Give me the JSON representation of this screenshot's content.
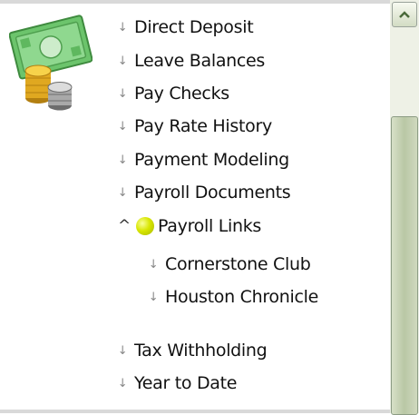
{
  "menu": {
    "items": [
      {
        "label": "Direct Deposit",
        "bullet": "↓"
      },
      {
        "label": "Leave Balances",
        "bullet": "↓"
      },
      {
        "label": "Pay Checks",
        "bullet": "↓"
      },
      {
        "label": "Pay Rate History",
        "bullet": "↓"
      },
      {
        "label": "Payment Modeling",
        "bullet": "↓"
      },
      {
        "label": "Payroll Documents",
        "bullet": "↓"
      },
      {
        "label": "Payroll Links",
        "bullet": "^",
        "expanded": true
      },
      {
        "label": "Cornerstone Club",
        "bullet": "↓"
      },
      {
        "label": "Houston Chronicle",
        "bullet": "↓"
      },
      {
        "label": "Tax Withholding",
        "bullet": "↓"
      },
      {
        "label": "Year to Date",
        "bullet": "↓"
      }
    ]
  },
  "icons": {
    "header": "money-icon",
    "scroll_up": "chevron-up-icon",
    "expanded_bullet": "yellow-dot-icon"
  },
  "colors": {
    "scroll_thumb": "#b9c7a5",
    "scroll_track": "#eef1e6",
    "bullet": "#d8e600"
  }
}
